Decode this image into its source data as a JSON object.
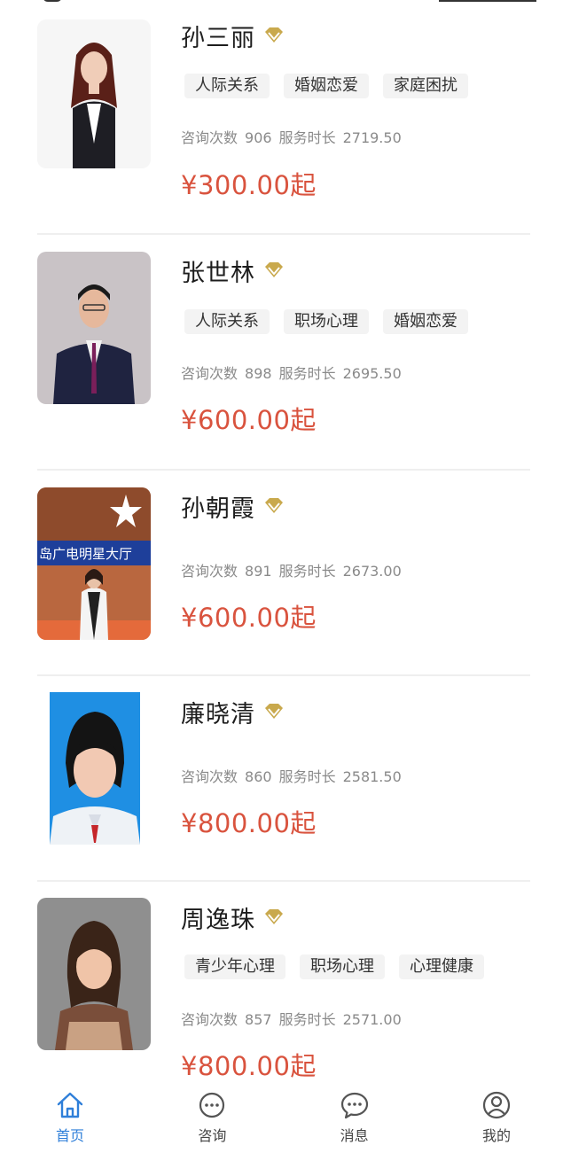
{
  "colors": {
    "accent": "#2f7fd9",
    "price": "#d9533e",
    "vip_gold": "#c9a94d",
    "tag_bg": "#f3f3f3",
    "stats_text": "#8a8a8a"
  },
  "counselors": [
    {
      "name": "孙三丽",
      "badge_icon": "vip-diamond-icon",
      "tags": [
        "人际关系",
        "婚姻恋爱",
        "家庭困扰"
      ],
      "consult_label": "咨询次数",
      "consult_count": "906",
      "duration_label": "服务时长",
      "duration": "2719.50",
      "price": "¥300.00起"
    },
    {
      "name": "张世林",
      "badge_icon": "vip-diamond-icon",
      "tags": [
        "人际关系",
        "职场心理",
        "婚姻恋爱"
      ],
      "consult_label": "咨询次数",
      "consult_count": "898",
      "duration_label": "服务时长",
      "duration": "2695.50",
      "price": "¥600.00起"
    },
    {
      "name": "孙朝霞",
      "badge_icon": "vip-diamond-icon",
      "tags": [],
      "consult_label": "咨询次数",
      "consult_count": "891",
      "duration_label": "服务时长",
      "duration": "2673.00",
      "price": "¥600.00起",
      "photo_text": "岛广电明星大厅"
    },
    {
      "name": "廉晓清",
      "badge_icon": "vip-diamond-icon",
      "tags": [],
      "consult_label": "咨询次数",
      "consult_count": "860",
      "duration_label": "服务时长",
      "duration": "2581.50",
      "price": "¥800.00起"
    },
    {
      "name": "周逸珠",
      "badge_icon": "vip-diamond-icon",
      "tags": [
        "青少年心理",
        "职场心理",
        "心理健康"
      ],
      "consult_label": "咨询次数",
      "consult_count": "857",
      "duration_label": "服务时长",
      "duration": "2571.00",
      "price": "¥800.00起"
    }
  ],
  "tabbar": {
    "items": [
      {
        "label": "首页",
        "icon": "home-icon",
        "active": true
      },
      {
        "label": "咨询",
        "icon": "chat-dots-icon",
        "active": false
      },
      {
        "label": "消息",
        "icon": "message-bubble-icon",
        "active": false
      },
      {
        "label": "我的",
        "icon": "user-profile-icon",
        "active": false
      }
    ]
  }
}
